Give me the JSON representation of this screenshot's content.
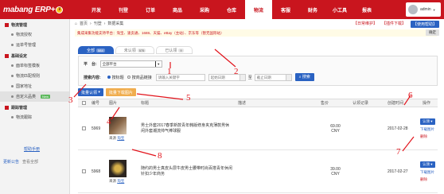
{
  "app": {
    "logo_text": "mabang ERP+",
    "logo_icon": "coin-icon",
    "nav": [
      "开发",
      "刊登",
      "订单",
      "商品",
      "采购",
      "仓库",
      "物流",
      "客服",
      "财务",
      "小工具",
      "报表"
    ],
    "active_nav": "物流",
    "user": "admin"
  },
  "sidebar": {
    "groups": [
      {
        "label": "物流管理",
        "items": [
          "物流授权",
          "运单号管理"
        ]
      },
      {
        "label": "基础设定",
        "items": [
          "面单标签模板",
          "物流匹配规则",
          "国家地址",
          "自定义品类"
        ]
      },
      {
        "label": "跟踪管理",
        "items": [
          "物流跟踪"
        ]
      }
    ],
    "new_badge": "New",
    "help": "帮助手册",
    "notice": "更新公告",
    "notice_extra": "查看全部"
  },
  "header": {
    "breadcrumb": [
      "首页",
      "刊登",
      "数据采集"
    ],
    "links": [
      "【日常维护】",
      "【插件下载】",
      "【使用帮助】"
    ],
    "notice": "集成采集功能支持平台：淘宝、速卖通、1688、天猫、eBay（主站）、京东等（暂无国际站）",
    "notice_btn": "确定"
  },
  "tabs": [
    {
      "label": "全部",
      "count": "584"
    },
    {
      "label": "未认领",
      "count": "575"
    },
    {
      "label": "已认领",
      "count": "9"
    }
  ],
  "filters": {
    "platform_label": "平　台:",
    "platform_value": "全部平台",
    "search_label": "搜索内容:",
    "radio_1": "按标题",
    "radio_2": "按商品链接",
    "input_placeholder": "请输入关键字",
    "date_start": "起始日期",
    "date_end": "截止日期",
    "date_sep": "至",
    "search_btn": "搜索"
  },
  "actions": {
    "bulk_claim": "批量认领",
    "bulk_download": "批量下载图片"
  },
  "table": {
    "headers": [
      "编号",
      "图片",
      "标题",
      "描述",
      "售价",
      "认领记录",
      "创建时间",
      "操作"
    ],
    "rows": [
      {
        "id": "5969",
        "title": "男士外套2017春季新款青年韩版修身夹克薄款男休闲外套潮流帅气棒球服",
        "price": "69.00",
        "currency": "CNY",
        "date": "2017-02-28",
        "source_label": "来源",
        "source": "淘宝"
      },
      {
        "id": "5968",
        "title": "随约的男士真皮头层牛皮男士腰带时尚百搭青年休闲针扣少年商务",
        "price": "39.00",
        "currency": "CNY",
        "date": "2017-02-27",
        "source_label": "来源",
        "source": "淘宝"
      }
    ],
    "op_claim": "认领",
    "op_download": "下载图片",
    "op_delete": "删除"
  },
  "annotations": [
    "1",
    "2",
    "3",
    "4",
    "5",
    "6",
    "7",
    "8"
  ],
  "colors": {
    "brand_red": "#c9151e",
    "link_blue": "#2a62c2",
    "annotation_red": "#e2141c"
  }
}
